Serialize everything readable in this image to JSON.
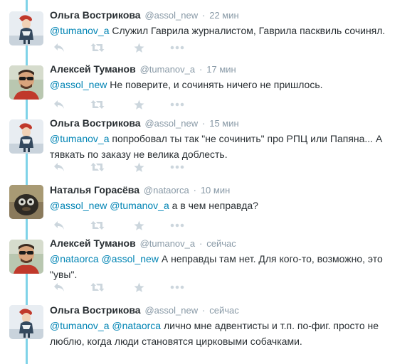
{
  "tweets": [
    {
      "fullname": "Ольга Вострикова",
      "username": "@assol_new",
      "sep": "·",
      "time": "22 мин",
      "segments": [
        {
          "type": "mention",
          "text": "@tumanov_a"
        },
        {
          "type": "text",
          "text": " Служил Гаврила журналистом, Гаврила пасквиль сочинял."
        }
      ],
      "avatar": "olga"
    },
    {
      "fullname": "Алексей Туманов",
      "username": "@tumanov_a",
      "sep": "·",
      "time": "17 мин",
      "segments": [
        {
          "type": "mention",
          "text": "@assol_new"
        },
        {
          "type": "text",
          "text": " Не поверите, и сочинять ничего не пришлось."
        }
      ],
      "avatar": "alexey"
    },
    {
      "fullname": "Ольга Вострикова",
      "username": "@assol_new",
      "sep": "·",
      "time": "15 мин",
      "segments": [
        {
          "type": "mention",
          "text": "@tumanov_a"
        },
        {
          "type": "text",
          "text": " попробовал ты так \"не сочинить\" про РПЦ или Папяна... А тявкать по заказу не велика доблесть."
        }
      ],
      "avatar": "olga"
    },
    {
      "fullname": "Наталья Горасёва",
      "username": "@nataorca",
      "sep": "·",
      "time": "10 мин",
      "segments": [
        {
          "type": "mention",
          "text": "@assol_new"
        },
        {
          "type": "text",
          "text": " "
        },
        {
          "type": "mention",
          "text": "@tumanov_a"
        },
        {
          "type": "text",
          "text": " а в чем неправда?"
        }
      ],
      "avatar": "natalya"
    },
    {
      "fullname": "Алексей Туманов",
      "username": "@tumanov_a",
      "sep": "·",
      "time": "сейчас",
      "segments": [
        {
          "type": "mention",
          "text": "@nataorca"
        },
        {
          "type": "text",
          "text": " "
        },
        {
          "type": "mention",
          "text": "@assol_new"
        },
        {
          "type": "text",
          "text": " А неправды там нет. Для кого-то, возможно, это \"увы\"."
        }
      ],
      "avatar": "alexey"
    },
    {
      "fullname": "Ольга Вострикова",
      "username": "@assol_new",
      "sep": "·",
      "time": "сейчас",
      "segments": [
        {
          "type": "mention",
          "text": "@tumanov_a"
        },
        {
          "type": "text",
          "text": " "
        },
        {
          "type": "mention",
          "text": "@nataorca"
        },
        {
          "type": "text",
          "text": " лично мне адвентисты и т.п. по-фиг. просто не люблю, когда люди становятся цирковыми собачками."
        }
      ],
      "avatar": "olga"
    }
  ],
  "icons": {
    "reply": "reply-icon",
    "retweet": "retweet-icon",
    "favorite": "star-icon",
    "more": "more-icon"
  },
  "colors": {
    "link": "#0084b4",
    "muted": "#8899a6",
    "icon": "#ccd6dd",
    "thread": "#7fd3e8"
  }
}
